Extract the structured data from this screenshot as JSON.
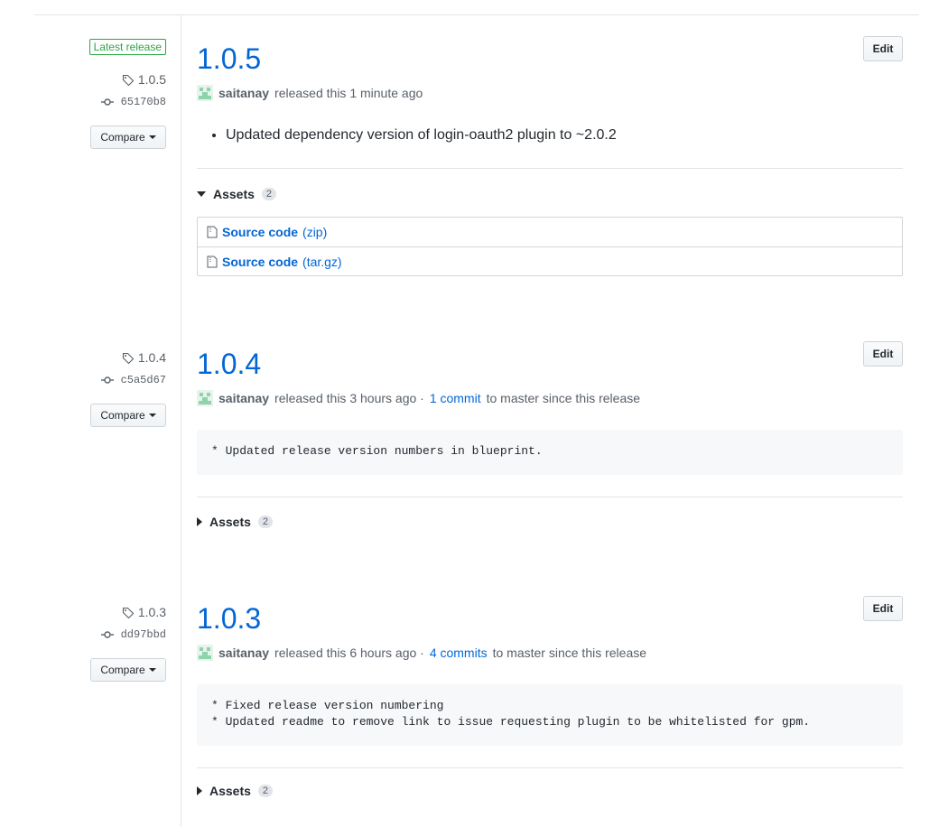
{
  "releases": [
    {
      "latest_label": "Latest release",
      "tag": "1.0.5",
      "commit": "65170b8",
      "compare_label": "Compare",
      "edit_label": "Edit",
      "title": "1.0.5",
      "author": "saitanay",
      "released_text": "released this 1 minute ago",
      "note": "Updated dependency version of login-oauth2 plugin to ~2.0.2",
      "assets_label": "Assets",
      "assets_count": "2",
      "assets": [
        {
          "name": "Source code",
          "ext": "(zip)"
        },
        {
          "name": "Source code",
          "ext": "(tar.gz)"
        }
      ]
    },
    {
      "tag": "1.0.4",
      "commit": "c5a5d67",
      "compare_label": "Compare",
      "edit_label": "Edit",
      "title": "1.0.4",
      "author": "saitanay",
      "released_text": "released this 3 hours ago ·",
      "commits_link": "1 commit",
      "since_text": "to master since this release",
      "code": "* Updated release version numbers in blueprint.",
      "assets_label": "Assets",
      "assets_count": "2"
    },
    {
      "tag": "1.0.3",
      "commit": "dd97bbd",
      "compare_label": "Compare",
      "edit_label": "Edit",
      "title": "1.0.3",
      "author": "saitanay",
      "released_text": "released this 6 hours ago ·",
      "commits_link": "4 commits",
      "since_text": "to master since this release",
      "code": "* Fixed release version numbering\n* Updated readme to remove link to issue requesting plugin to be whitelisted for gpm.",
      "assets_label": "Assets",
      "assets_count": "2"
    }
  ]
}
